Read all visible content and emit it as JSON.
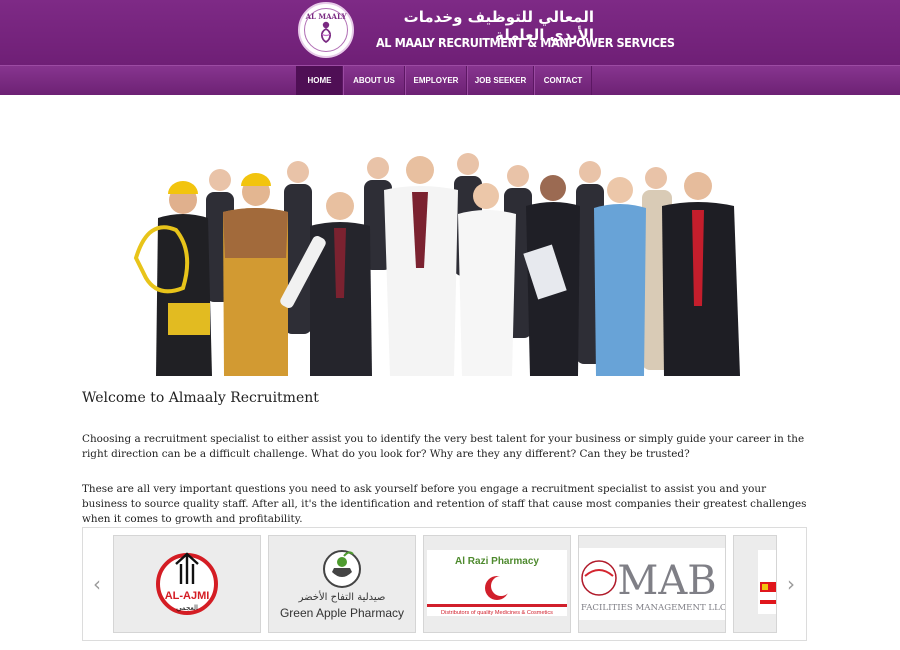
{
  "header": {
    "logo_text": "AL MAALY",
    "arabic_title": "المعالي للتوظيف وخدمات الأيدي العاملة",
    "english_title": "AL MAALY RECRUITMENT & MANPOWER SERVICES"
  },
  "nav": {
    "items": [
      {
        "label": "HOME",
        "active": true
      },
      {
        "label": "ABOUT US",
        "active": false
      },
      {
        "label": "EMPLOYER",
        "active": false
      },
      {
        "label": "JOB SEEKER",
        "active": false
      },
      {
        "label": "CONTACT",
        "active": false
      }
    ]
  },
  "hero": {
    "image": "group of professionals in various work uniforms"
  },
  "main": {
    "welcome_title": "Welcome to Almaaly Recruitment",
    "paragraph_1": "Choosing a recruitment specialist to either assist you to identify the very best talent for your business or simply guide your career in the right direction can be a difficult challenge. What do you look for? Why are they any different? Can they be trusted?",
    "paragraph_2": "These are all very important questions you need to ask yourself before you engage a recruitment specialist to assist you and your business to source quality staff. After all, it's the identification and retention of staff that cause most companies their greatest challenges when it comes to growth and profitability."
  },
  "carousel": {
    "prev_icon": "chevron-left-icon",
    "next_icon": "chevron-right-icon",
    "logos": [
      {
        "name": "AL-AJMI",
        "arabic": "العجمي"
      },
      {
        "name": "Green Apple Pharmacy",
        "arabic": "صيدلية التفاح الأخضر"
      },
      {
        "name": "Al Razi Pharmacy",
        "tagline": "Distributors of quality Medicines & Cosmetics"
      },
      {
        "name": "MAB",
        "tagline": "FACILITIES MANAGEMENT LLC"
      }
    ]
  },
  "colors": {
    "header_purple": "#7e2a86",
    "nav_active": "#4f0f55"
  }
}
